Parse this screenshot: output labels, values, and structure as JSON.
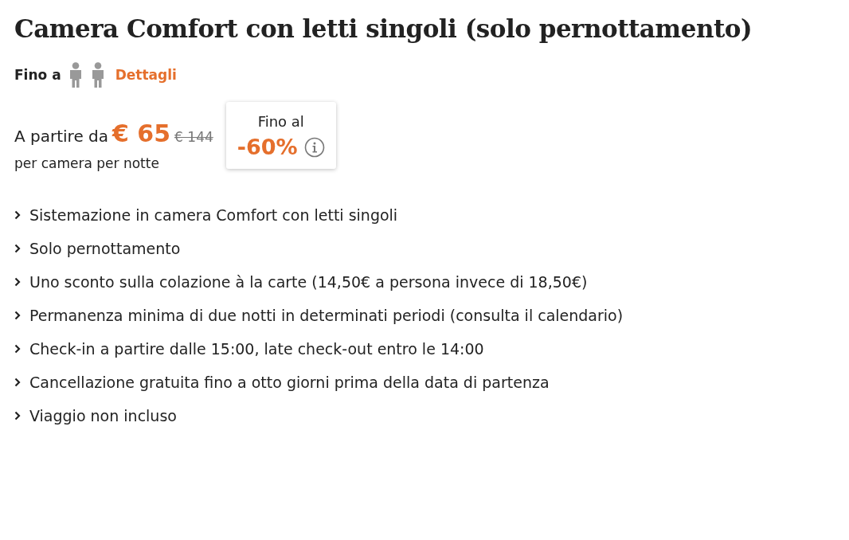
{
  "title": "Camera Comfort con letti singoli (solo pernottamento)",
  "occupancy": {
    "label": "Fino a",
    "guests": [
      {
        "kind": "adult"
      },
      {
        "kind": "adult"
      }
    ],
    "link": "Dettagli"
  },
  "price": {
    "prefix": "A partire da",
    "current": "€ 65",
    "original": "€ 144",
    "unit": "per camera per notte"
  },
  "discount": {
    "label": "Fino al",
    "value": "-60%"
  },
  "features": [
    "Sistemazione in camera Comfort con letti singoli",
    "Solo pernottamento",
    "Uno sconto sulla colazione à la carte (14,50€ a persona invece di 18,50€)",
    "Permanenza minima di due notti in determinati periodi (consulta il calendario)",
    "Check-in a partire dalle 15:00, late check-out entro le 14:00",
    "Cancellazione gratuita fino a otto giorni prima della data di partenza",
    "Viaggio non incluso"
  ]
}
